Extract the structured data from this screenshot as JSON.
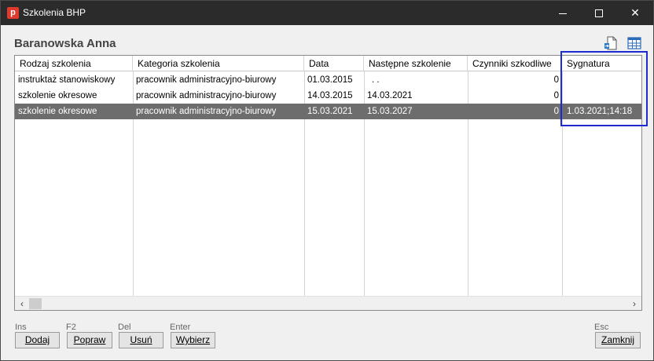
{
  "window": {
    "title": "Szkolenia BHP"
  },
  "app_icon_letter": "p",
  "person_name": "Baranowska Anna",
  "columns": [
    "Rodzaj szkolenia",
    "Kategoria szkolenia",
    "Data",
    "Następne szkolenie",
    "Czynniki szkodliwe",
    "Sygnatura"
  ],
  "rows": [
    {
      "rodzaj": "instruktaż stanowiskowy",
      "kategoria": "pracownik administracyjno-biurowy",
      "data": "01.03.2015",
      "nastepne": ". .",
      "czynniki": "0",
      "sygnatura": "",
      "selected": false
    },
    {
      "rodzaj": "szkolenie okresowe",
      "kategoria": "pracownik administracyjno-biurowy",
      "data": "14.03.2015",
      "nastepne": "14.03.2021",
      "czynniki": "0",
      "sygnatura": "",
      "selected": false
    },
    {
      "rodzaj": "szkolenie okresowe",
      "kategoria": "pracownik administracyjno-biurowy",
      "data": "15.03.2021",
      "nastepne": "15.03.2027",
      "czynniki": "0",
      "sygnatura": "1.03.2021;14:18",
      "selected": true
    }
  ],
  "footer": {
    "shortcuts": {
      "add": "Ins",
      "edit": "F2",
      "delete": "Del",
      "select": "Enter",
      "close": "Esc"
    },
    "buttons": {
      "add": "Dodaj",
      "edit": "Popraw",
      "delete": "Usuń",
      "select": "Wybierz",
      "close": "Zamknij"
    }
  },
  "colors": {
    "titlebar": "#2b2b2b",
    "selected_row": "#6d6d6d",
    "highlight_box": "#1d2cd0",
    "app_icon": "#e03a2e"
  }
}
